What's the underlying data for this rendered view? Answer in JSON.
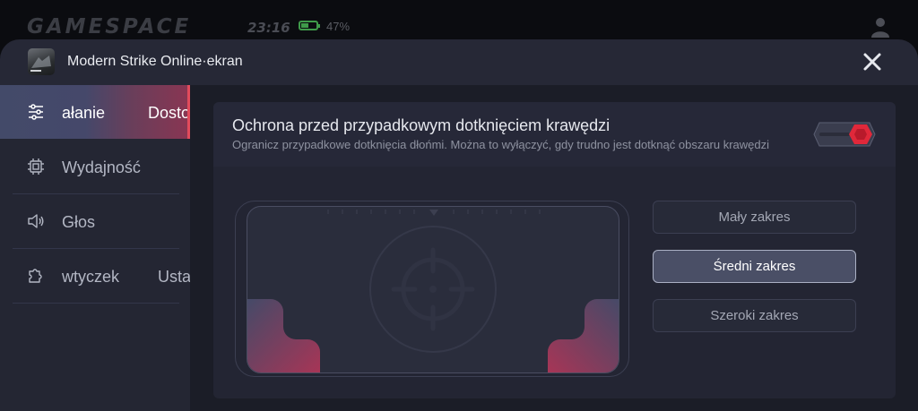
{
  "statusbar": {
    "brand": "GAMESPACE",
    "time": "23:16",
    "battery_percent": "47%",
    "battery_level": 0.47
  },
  "header": {
    "title": "Modern Strike Online·ekran"
  },
  "sidebar": {
    "items": [
      {
        "label": "ałanie",
        "label_right": "Dosto",
        "active": true,
        "icon": "sliders-icon"
      },
      {
        "label": "Wydajność",
        "active": false,
        "icon": "chip-icon"
      },
      {
        "label": "Głos",
        "active": false,
        "icon": "speaker-icon"
      },
      {
        "label": "wtyczek",
        "label_right": "Usta",
        "active": false,
        "icon": "puzzle-icon"
      }
    ]
  },
  "main": {
    "card": {
      "title": "Ochrona przed przypadkowym dotknięciem krawędzi",
      "description": "Ogranicz przypadkowe dotknięcia dłońmi. Można to wyłączyć, gdy trudno jest dotknąć obszaru krawędzi",
      "toggle_on": true
    },
    "ranges": [
      {
        "label": "Mały zakres",
        "selected": false
      },
      {
        "label": "Średni zakres",
        "selected": true
      },
      {
        "label": "Szeroki zakres",
        "selected": false
      }
    ]
  },
  "colors": {
    "accent_red": "#e0283a",
    "active_tab_gradient_end": "#8a3552",
    "battery_green": "#3f9a4a"
  }
}
